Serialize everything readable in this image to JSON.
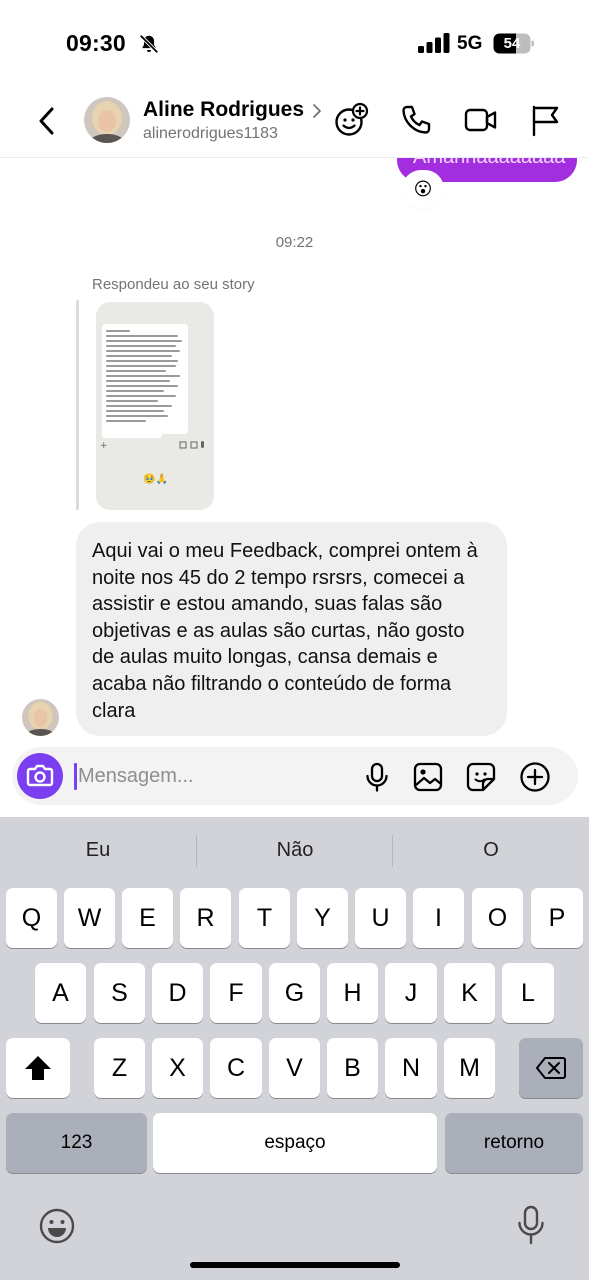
{
  "status_bar": {
    "time": "09:30",
    "network": "5G",
    "battery": "54",
    "icons": [
      "bell-slash-icon",
      "signal-icon",
      "battery-icon"
    ]
  },
  "header": {
    "contact_name": "Aline Rodrigues",
    "username": "alinerodrigues1183",
    "icons": [
      "back-chevron-icon",
      "chevron-right-icon",
      "emoji-add-icon",
      "phone-icon",
      "video-icon",
      "flag-icon"
    ]
  },
  "chat": {
    "sent_message_partial": "Amanhãaaaaaaa",
    "reaction_emoji": "😮",
    "timestamp": "09:22",
    "reply_label": "Respondeu ao seu story",
    "story_emoji": "🥹🙏",
    "message": "Aqui vai o meu Feedback, comprei ontem à noite nos 45 do 2 tempo rsrsrs, comecei a assistir e estou amando, suas falas são objetivas e as aulas são curtas, não gosto de aulas muito longas, cansa demais e acaba não filtrando o conteúdo de forma clara"
  },
  "composer": {
    "placeholder": "Mensagem...",
    "value": "",
    "icons": [
      "camera-icon",
      "microphone-icon",
      "image-icon",
      "sticker-icon",
      "plus-circle-icon"
    ]
  },
  "keyboard": {
    "suggestions": [
      "Eu",
      "Não",
      "O"
    ],
    "row1": [
      "Q",
      "W",
      "E",
      "R",
      "T",
      "Y",
      "U",
      "I",
      "O",
      "P"
    ],
    "row2": [
      "A",
      "S",
      "D",
      "F",
      "G",
      "H",
      "J",
      "K",
      "L"
    ],
    "row3": [
      "Z",
      "X",
      "C",
      "V",
      "B",
      "N",
      "M"
    ],
    "numbers_key": "123",
    "space_key": "espaço",
    "return_key": "retorno",
    "icons": [
      "shift-icon",
      "backspace-icon",
      "emoji-icon",
      "dictation-mic-icon"
    ]
  },
  "colors": {
    "accent_purple": "#7b3ff2",
    "sent_bubble": "#a22ee0",
    "received_bubble": "#efefef",
    "keyboard_bg": "#d1d3d9"
  }
}
